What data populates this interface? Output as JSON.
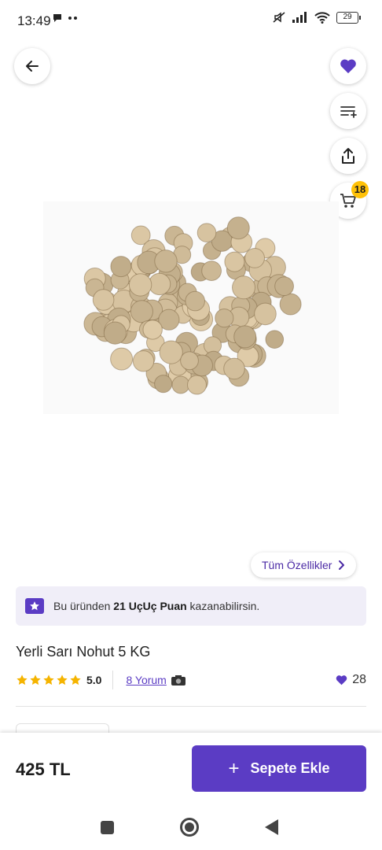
{
  "status_bar": {
    "time": "13:49",
    "battery": "29"
  },
  "header": {
    "back_icon": "arrow-left-icon",
    "favorite_icon": "heart-icon",
    "list_icon": "add-to-list-icon",
    "share_icon": "share-icon",
    "cart_icon": "cart-icon",
    "cart_count": "18"
  },
  "product": {
    "image_icon": "chickpeas-photo",
    "all_specs_label": "Tüm Özellikler",
    "points_prefix": "Bu üründen ",
    "points_bold": "21 UçUç Puan",
    "points_suffix": " kazanabilirsin.",
    "title": "Yerli Sarı Nohut 5 KG",
    "rating": "5.0",
    "stars": 5,
    "reviews_label": "8 Yorum",
    "likes": "28"
  },
  "bottom": {
    "price": "425 TL",
    "add_to_cart_label": "Sepete Ekle"
  },
  "colors": {
    "accent": "#5b3cc4",
    "badge": "#ffc107",
    "star": "#f5b400"
  }
}
